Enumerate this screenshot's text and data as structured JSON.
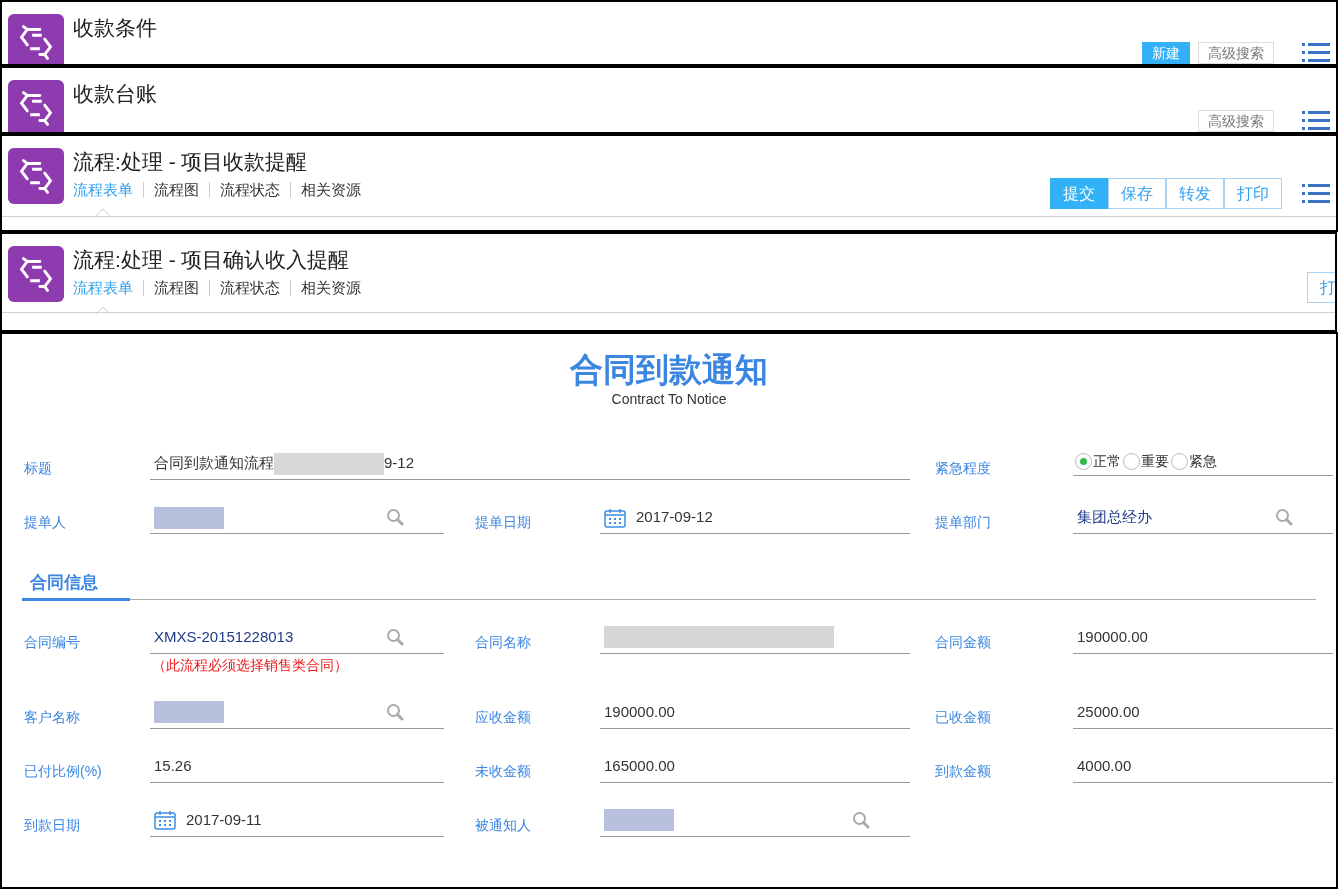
{
  "panels": [
    {
      "title": "收款条件",
      "buttons": [
        {
          "label": "新建",
          "primary": true
        },
        {
          "label": "高级搜索",
          "primary": false
        }
      ],
      "menu_button": true
    },
    {
      "title": "收款台账",
      "buttons": [
        {
          "label": "高级搜索",
          "primary": false
        }
      ],
      "menu_button": true
    },
    {
      "title": "流程:处理 - 项目收款提醒",
      "tabs": [
        {
          "label": "流程表单",
          "selected": true
        },
        {
          "label": "流程图",
          "selected": false
        },
        {
          "label": "流程状态",
          "selected": false
        },
        {
          "label": "相关资源",
          "selected": false
        }
      ],
      "buttons": [
        {
          "label": "提交",
          "primary": true
        },
        {
          "label": "保存",
          "primary": false
        },
        {
          "label": "转发",
          "primary": false
        },
        {
          "label": "打印",
          "primary": false
        }
      ],
      "menu_button": true
    },
    {
      "title": "流程:处理 - 项目确认收入提醒",
      "tabs": [
        {
          "label": "流程表单",
          "selected": true
        },
        {
          "label": "流程图",
          "selected": false
        },
        {
          "label": "流程状态",
          "selected": false
        },
        {
          "label": "相关资源",
          "selected": false
        }
      ],
      "buttons": [
        {
          "label": "打",
          "primary": false
        }
      ],
      "menu_button": false
    }
  ],
  "form": {
    "title": "合同到款通知",
    "subtitle": "Contract To Notice",
    "sections": [
      {
        "rows": [
          [
            {
              "label": "标题",
              "kind": "text",
              "value": "合同到款通知流程",
              "redacted": true,
              "value_after": "9-12"
            },
            "",
            {
              "label": "紧急程度",
              "kind": "radio",
              "options": [
                {
                  "label": "正常",
                  "selected": true
                },
                {
                  "label": "重要",
                  "selected": false
                },
                {
                  "label": "紧急",
                  "selected": false
                }
              ]
            }
          ],
          [
            {
              "label": "提单人",
              "kind": "lookup",
              "redacted": true
            },
            {
              "label": "提单日期",
              "kind": "date",
              "value": "2017-09-12"
            },
            {
              "label": "提单部门",
              "kind": "lookup",
              "value": "集团总经办"
            }
          ]
        ]
      },
      {
        "heading": "合同信息",
        "rows": [
          [
            {
              "label": "合同编号",
              "kind": "lookup",
              "value": "XMXS-20151228013",
              "note": "（此流程必须选择销售类合同）"
            },
            {
              "label": "合同名称",
              "kind": "text",
              "redacted": true
            },
            {
              "label": "合同金额",
              "kind": "text",
              "value": "190000.00"
            }
          ],
          [
            {
              "label": "客户名称",
              "kind": "lookup",
              "redacted": true
            },
            {
              "label": "应收金额",
              "kind": "text",
              "value": "190000.00"
            },
            {
              "label": "已收金额",
              "kind": "text",
              "value": "25000.00"
            }
          ],
          [
            {
              "label": "已付比例(%)",
              "kind": "text",
              "value": "15.26"
            },
            {
              "label": "未收金额",
              "kind": "text",
              "value": "165000.00"
            },
            {
              "label": "到款金额",
              "kind": "text",
              "value": "4000.00"
            }
          ],
          [
            {
              "label": "到款日期",
              "kind": "date",
              "value": "2017-09-11"
            },
            {
              "label": "被通知人",
              "kind": "lookup",
              "redacted": true
            }
          ]
        ]
      }
    ]
  }
}
